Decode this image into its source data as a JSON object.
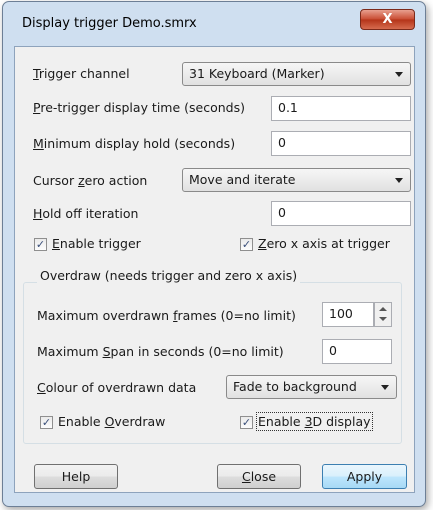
{
  "window": {
    "title": "Display trigger Demo.smrx",
    "close_glyph": "X"
  },
  "fields": {
    "trigger_channel": {
      "label_u": "T",
      "label_rest": "rigger channel",
      "value": "31 Keyboard (Marker)"
    },
    "pretrigger": {
      "label_u": "P",
      "label_rest": "re-trigger display time (seconds)",
      "value": "0.1"
    },
    "min_hold": {
      "label_u": "M",
      "label_rest": "inimum display hold (seconds)",
      "value": "0"
    },
    "cursor_zero": {
      "label_pre": "Cursor ",
      "label_u": "z",
      "label_rest": "ero action",
      "value": "Move and iterate"
    },
    "hold_off": {
      "label_u": "H",
      "label_rest": "old off iteration",
      "value": "0"
    },
    "enable_trigger": {
      "label_u": "E",
      "label_rest": "nable trigger",
      "checked": true
    },
    "zero_x": {
      "label_u": "Z",
      "label_rest": "ero x axis at trigger",
      "checked": true
    }
  },
  "overdraw": {
    "group_label": "Overdraw (needs trigger and zero x axis)",
    "max_frames": {
      "label_pre": "Maximum overdrawn ",
      "label_u": "f",
      "label_rest": "rames (0=no limit)",
      "value": "100"
    },
    "max_span": {
      "label_pre": "Maximum ",
      "label_u": "S",
      "label_rest": "pan in seconds (0=no limit)",
      "value": "0"
    },
    "colour": {
      "label_u": "C",
      "label_rest": "olour of overdrawn data",
      "value": "Fade to background"
    },
    "enable_overdraw": {
      "label_pre": "Enable ",
      "label_u": "O",
      "label_rest": "verdraw",
      "checked": true
    },
    "enable_3d": {
      "label_pre": "Enable ",
      "label_u": "3",
      "label_rest": "D display",
      "checked": true
    }
  },
  "buttons": {
    "help": "Help",
    "close_u": "C",
    "close_rest": "lose",
    "apply": "Apply"
  },
  "check_glyph": "✓"
}
